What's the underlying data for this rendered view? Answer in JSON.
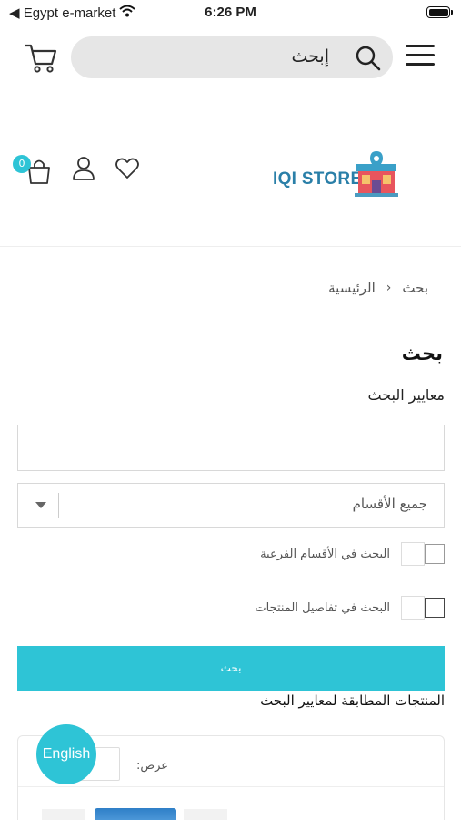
{
  "status_bar": {
    "carrier": "◀ Egypt e-market",
    "time": "6:26 PM"
  },
  "top_bar": {
    "search_text": "إبحث"
  },
  "header": {
    "cart_count": "0",
    "logo_text": "IQI STORE"
  },
  "breadcrumb": {
    "home": "الرئيسية",
    "separator": "‹",
    "current": "بحث"
  },
  "page": {
    "title": "بحث",
    "criteria_label": "معايير البحث"
  },
  "form": {
    "keyword_value": "",
    "category_selected": "جميع الأقسام",
    "subcategories_label": "البحث في الأقسام الفرعية",
    "descriptions_label": "البحث في تفاصيل المنتجات",
    "submit_label": "بحث"
  },
  "results": {
    "label": "المنتجات المطابقة لمعايير البحث",
    "show_label": "عرض:"
  },
  "language_button": "English",
  "colors": {
    "accent": "#2ec4d6",
    "logo_text": "#2a7fa8"
  }
}
